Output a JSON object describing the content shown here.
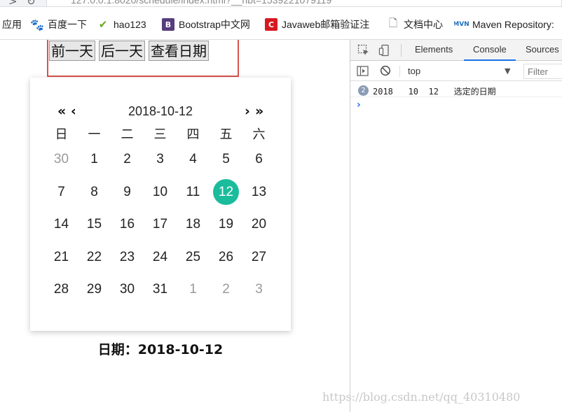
{
  "browser": {
    "url": "127.0.0.1:8020/schedule/index.html?__hbt=1539221079119"
  },
  "bookmarks": [
    {
      "label": "应用",
      "icon": "apps-icon"
    },
    {
      "label": "百度一下",
      "icon": "baidu-paw-icon",
      "color": "#2f6bdc"
    },
    {
      "label": "hao123",
      "icon": "hao123-icon",
      "color": "#6aa81e"
    },
    {
      "label": "Bootstrap中文网",
      "icon": "bootstrap-icon",
      "color": "#563d7c"
    },
    {
      "label": "Javaweb邮箱验证注",
      "icon": "csdn-c-icon",
      "color": "#d71920"
    },
    {
      "label": "文档中心",
      "icon": "document-icon"
    },
    {
      "label": "Maven Repository:",
      "icon": "maven-icon",
      "color": "#1f6fbf"
    }
  ],
  "page": {
    "buttons": {
      "prev": "前一天",
      "next": "后一天",
      "view": "查看日期"
    },
    "calendar": {
      "title": "2018-10-12",
      "prev_year": "«",
      "prev_month": "‹",
      "next_month": "›",
      "next_year": "»",
      "weekdays": [
        "日",
        "一",
        "二",
        "三",
        "四",
        "五",
        "六"
      ],
      "days": [
        {
          "d": "30",
          "other": true
        },
        {
          "d": "1"
        },
        {
          "d": "2"
        },
        {
          "d": "3"
        },
        {
          "d": "4"
        },
        {
          "d": "5"
        },
        {
          "d": "6"
        },
        {
          "d": "7"
        },
        {
          "d": "8"
        },
        {
          "d": "9"
        },
        {
          "d": "10"
        },
        {
          "d": "11"
        },
        {
          "d": "12",
          "selected": true
        },
        {
          "d": "13"
        },
        {
          "d": "14"
        },
        {
          "d": "15"
        },
        {
          "d": "16"
        },
        {
          "d": "17"
        },
        {
          "d": "18"
        },
        {
          "d": "19"
        },
        {
          "d": "20"
        },
        {
          "d": "21"
        },
        {
          "d": "22"
        },
        {
          "d": "23"
        },
        {
          "d": "24"
        },
        {
          "d": "25"
        },
        {
          "d": "26"
        },
        {
          "d": "27"
        },
        {
          "d": "28"
        },
        {
          "d": "29"
        },
        {
          "d": "30"
        },
        {
          "d": "31"
        },
        {
          "d": "1",
          "other": true
        },
        {
          "d": "2",
          "other": true
        },
        {
          "d": "3",
          "other": true
        }
      ],
      "selected_color": "#1abc9c"
    },
    "date_label": "日期：2018-10-12"
  },
  "devtools": {
    "tabs": [
      "Elements",
      "Console",
      "Sources"
    ],
    "active_tab": "Console",
    "context": "top",
    "filter_placeholder": "Filter",
    "log": {
      "count": "2",
      "message": "2018   10  12   选定的日期"
    },
    "prompt": "›"
  },
  "watermark": "https://blog.csdn.net/qq_40310480"
}
